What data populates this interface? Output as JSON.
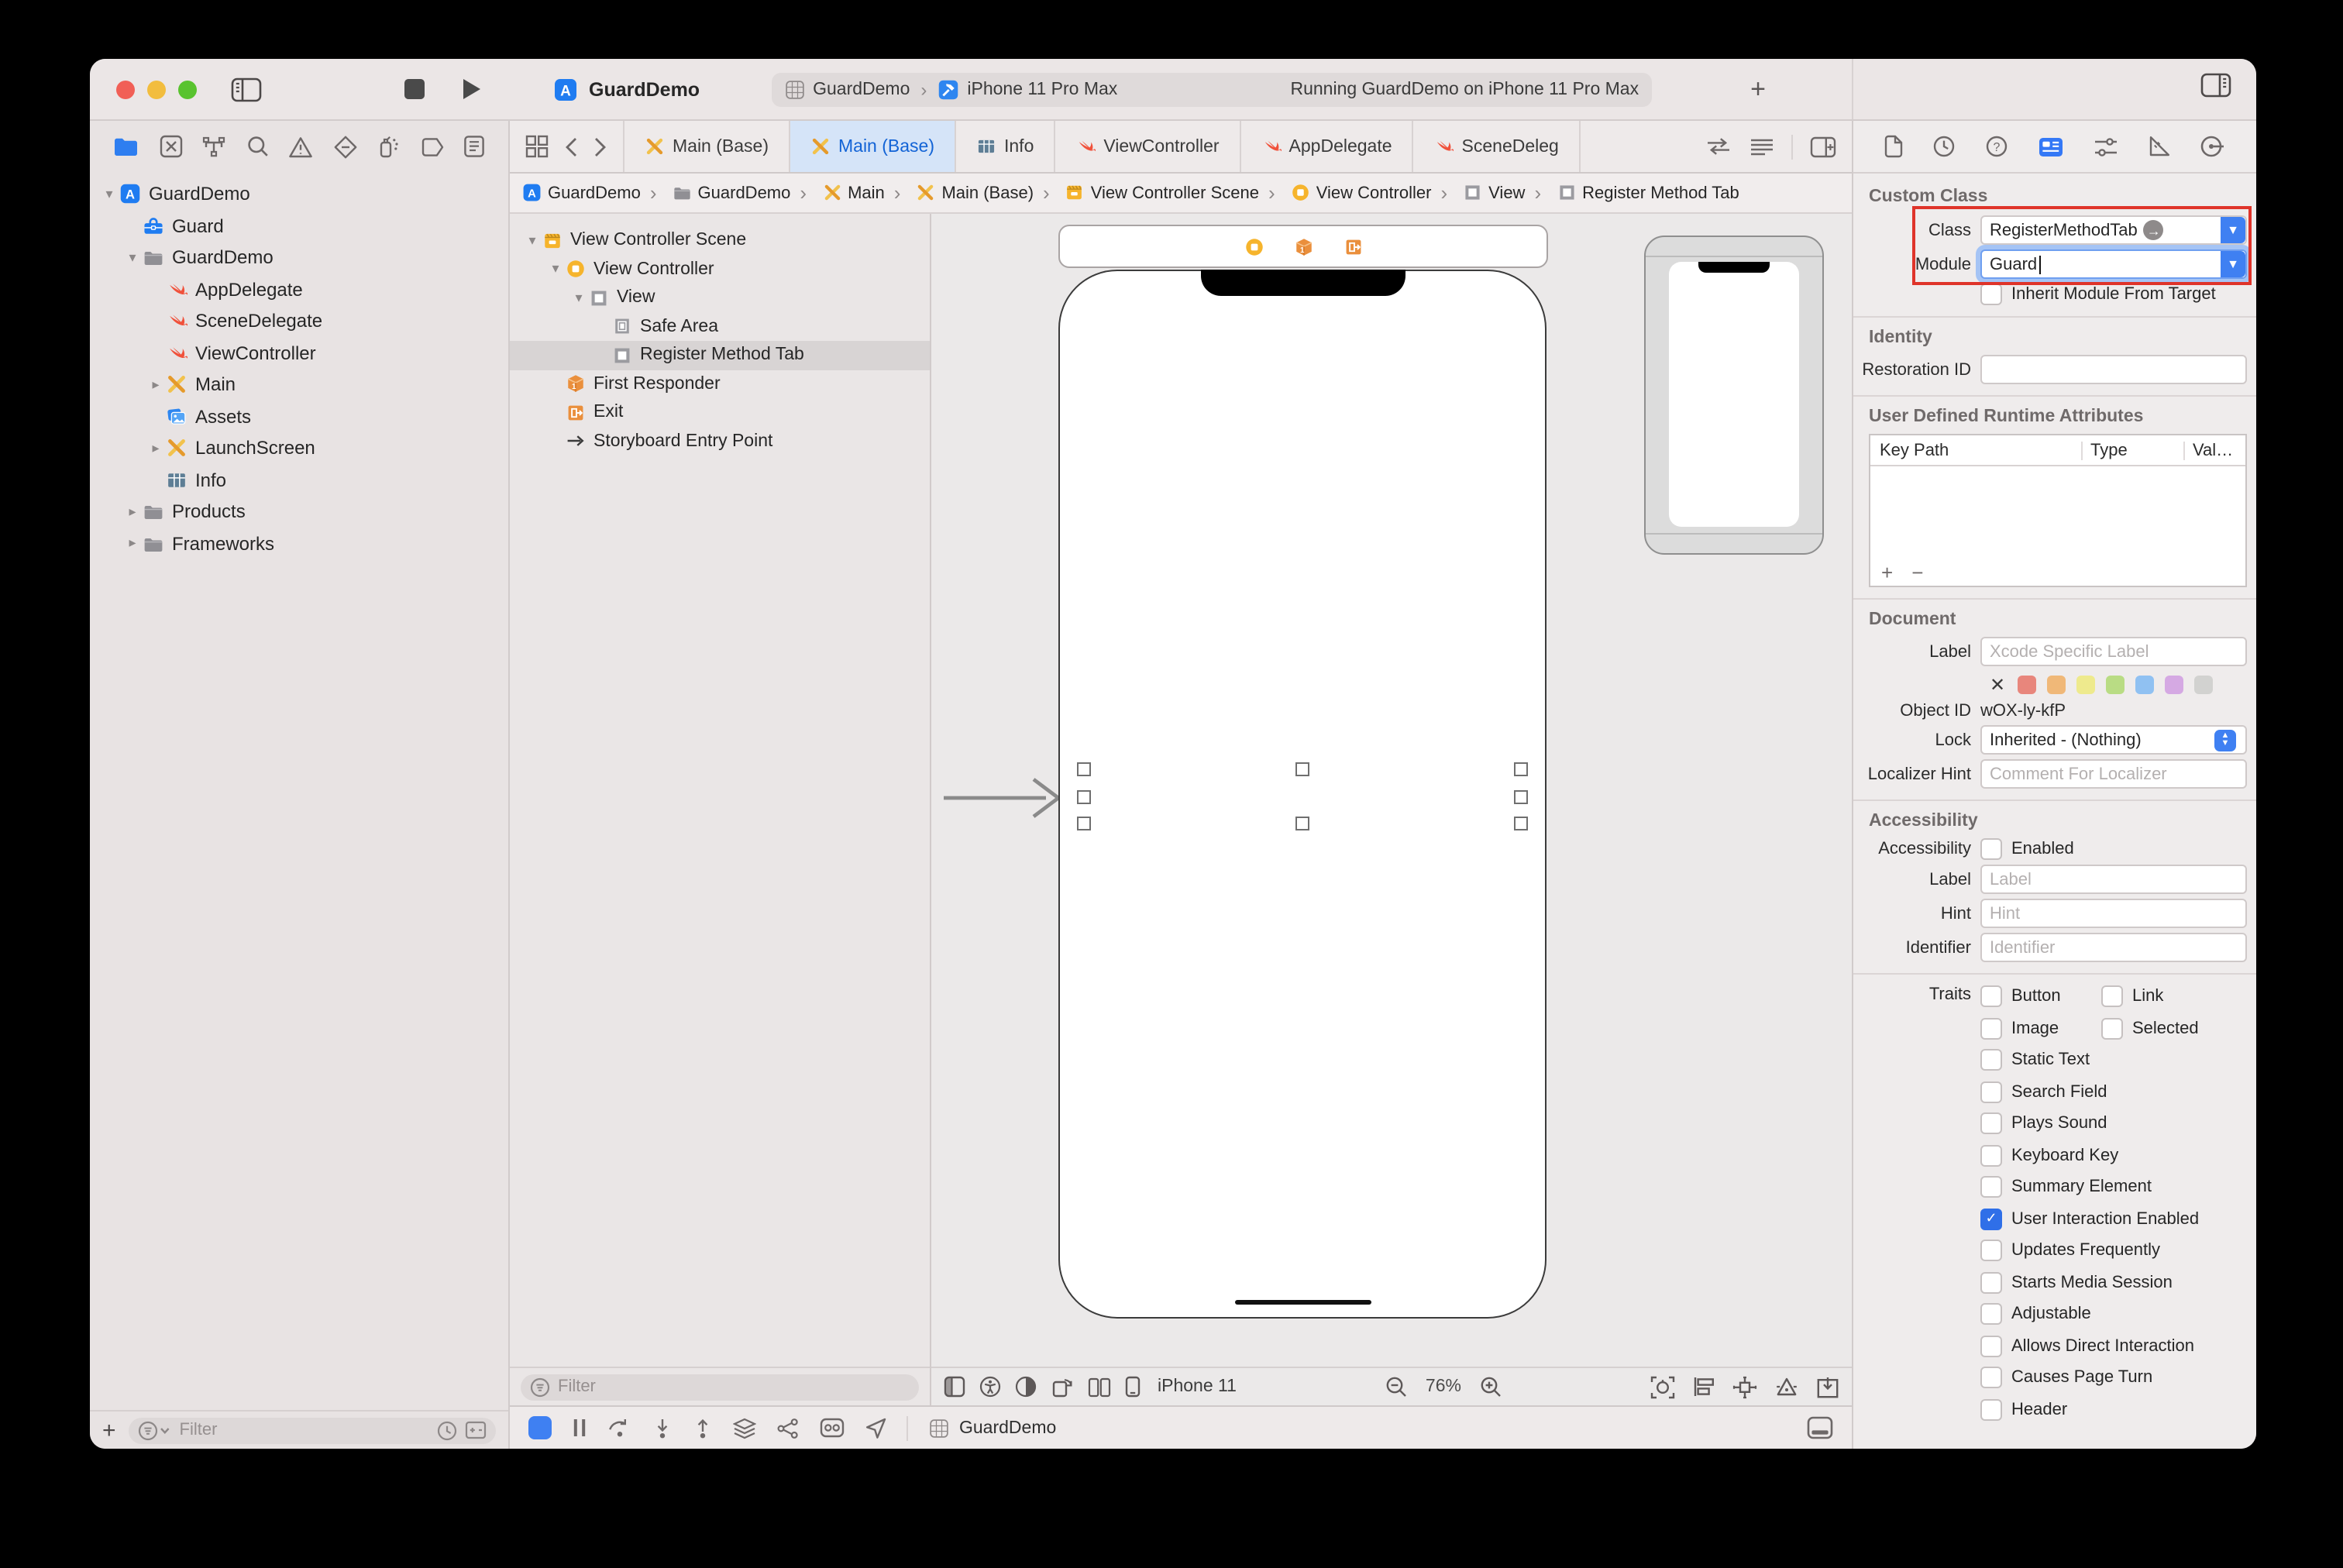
{
  "titlebar": {
    "app_title": "GuardDemo",
    "scheme_project": "GuardDemo",
    "run_destination": "iPhone 11 Pro Max",
    "status": "Running GuardDemo on iPhone 11 Pro Max",
    "add_tab": "+"
  },
  "editor_tabs": [
    {
      "label": "Main (Base)",
      "icon": "storyboard-x"
    },
    {
      "label": "Main (Base)",
      "icon": "storyboard-x",
      "state": "active"
    },
    {
      "label": "Info",
      "icon": "plist"
    },
    {
      "label": "ViewController",
      "icon": "swift"
    },
    {
      "label": "AppDelegate",
      "icon": "swift"
    },
    {
      "label": "SceneDeleg",
      "icon": "swift"
    }
  ],
  "breadcrumb": [
    {
      "label": "GuardDemo",
      "icon": "appstore"
    },
    {
      "label": "GuardDemo",
      "icon": "folder"
    },
    {
      "label": "Main",
      "icon": "storyboard-x"
    },
    {
      "label": "Main (Base)",
      "icon": "storyboard-x"
    },
    {
      "label": "View Controller Scene",
      "icon": "scene"
    },
    {
      "label": "View Controller",
      "icon": "vc"
    },
    {
      "label": "View",
      "icon": "view"
    },
    {
      "label": "Register Method Tab",
      "icon": "view"
    }
  ],
  "navigator": {
    "filter_placeholder": "Filter",
    "items": [
      {
        "label": "GuardDemo",
        "icon": "appstore",
        "level": 0,
        "disclosure": "open"
      },
      {
        "label": "Guard",
        "icon": "toolbox",
        "level": 1,
        "disclosure": "none"
      },
      {
        "label": "GuardDemo",
        "icon": "folder",
        "level": 1,
        "disclosure": "open"
      },
      {
        "label": "AppDelegate",
        "icon": "swift",
        "level": 2,
        "disclosure": "none"
      },
      {
        "label": "SceneDelegate",
        "icon": "swift",
        "level": 2,
        "disclosure": "none"
      },
      {
        "label": "ViewController",
        "icon": "swift",
        "level": 2,
        "disclosure": "none"
      },
      {
        "label": "Main",
        "icon": "storyboard-x",
        "level": 2,
        "disclosure": "closed"
      },
      {
        "label": "Assets",
        "icon": "assets",
        "level": 2,
        "disclosure": "none"
      },
      {
        "label": "LaunchScreen",
        "icon": "storyboard-x",
        "level": 2,
        "disclosure": "closed"
      },
      {
        "label": "Info",
        "icon": "plist",
        "level": 2,
        "disclosure": "none"
      },
      {
        "label": "Products",
        "icon": "folder",
        "level": 1,
        "disclosure": "closed"
      },
      {
        "label": "Frameworks",
        "icon": "folder",
        "level": 1,
        "disclosure": "closed"
      }
    ]
  },
  "outline": {
    "filter_placeholder": "Filter",
    "items": [
      {
        "label": "View Controller Scene",
        "icon": "scene",
        "level": 0,
        "disclosure": "open"
      },
      {
        "label": "View Controller",
        "icon": "vc",
        "level": 1,
        "disclosure": "open"
      },
      {
        "label": "View",
        "icon": "view",
        "level": 2,
        "disclosure": "open"
      },
      {
        "label": "Safe Area",
        "icon": "safearea",
        "level": 3,
        "disclosure": "none"
      },
      {
        "label": "Register Method Tab",
        "icon": "view",
        "level": 3,
        "disclosure": "none",
        "state": "selected"
      },
      {
        "label": "First Responder",
        "icon": "responder",
        "level": 1,
        "disclosure": "none"
      },
      {
        "label": "Exit",
        "icon": "exit",
        "level": 1,
        "disclosure": "none"
      },
      {
        "label": "Storyboard Entry Point",
        "icon": "entry",
        "level": 1,
        "disclosure": "none"
      }
    ]
  },
  "canvas": {
    "device_name": "iPhone 11",
    "zoom_level": "76%",
    "debug_project": "GuardDemo"
  },
  "inspector": {
    "custom_class": {
      "title": "Custom Class",
      "class_label": "Class",
      "class_value": "RegisterMethodTab",
      "module_label": "Module",
      "module_value": "Guard",
      "inherit_label": "Inherit Module From Target"
    },
    "identity": {
      "title": "Identity",
      "restoration_label": "Restoration ID"
    },
    "udra": {
      "title": "User Defined Runtime Attributes",
      "columns": [
        "Key Path",
        "Type",
        "Val…"
      ],
      "add_label": "+",
      "remove_label": "−"
    },
    "document": {
      "title": "Document",
      "label_label": "Label",
      "label_placeholder": "Xcode Specific Label",
      "clear_mark": "✕",
      "swatches": [
        {
          "color": "#e8867c"
        },
        {
          "color": "#f0b878"
        },
        {
          "color": "#eeea8d"
        },
        {
          "color": "#b9dc84"
        },
        {
          "color": "#90c1f2"
        },
        {
          "color": "#d5a9e3"
        },
        {
          "color": "#d2d2d0"
        }
      ],
      "object_id_label": "Object ID",
      "object_id": "wOX-ly-kfP",
      "lock_label": "Lock",
      "lock_value": "Inherited - (Nothing)",
      "localizer_label": "Localizer Hint",
      "localizer_placeholder": "Comment For Localizer"
    },
    "accessibility": {
      "title": "Accessibility",
      "enabled_row_label": "Accessibility",
      "enabled_label": "Enabled",
      "label_label": "Label",
      "label_placeholder": "Label",
      "hint_label": "Hint",
      "hint_placeholder": "Hint",
      "identifier_label": "Identifier",
      "identifier_placeholder": "Identifier",
      "traits_label": "Traits",
      "traits_grid": [
        {
          "label": "Button"
        },
        {
          "label": "Link"
        },
        {
          "label": "Image"
        },
        {
          "label": "Selected"
        }
      ],
      "traits_list": [
        {
          "label": "Static Text"
        },
        {
          "label": "Search Field"
        },
        {
          "label": "Plays Sound"
        },
        {
          "label": "Keyboard Key"
        },
        {
          "label": "Summary Element"
        },
        {
          "label": "User Interaction Enabled",
          "state": "on"
        },
        {
          "label": "Updates Frequently"
        },
        {
          "label": "Starts Media Session"
        },
        {
          "label": "Adjustable"
        },
        {
          "label": "Allows Direct Interaction"
        },
        {
          "label": "Causes Page Turn"
        },
        {
          "label": "Header"
        }
      ]
    }
  }
}
